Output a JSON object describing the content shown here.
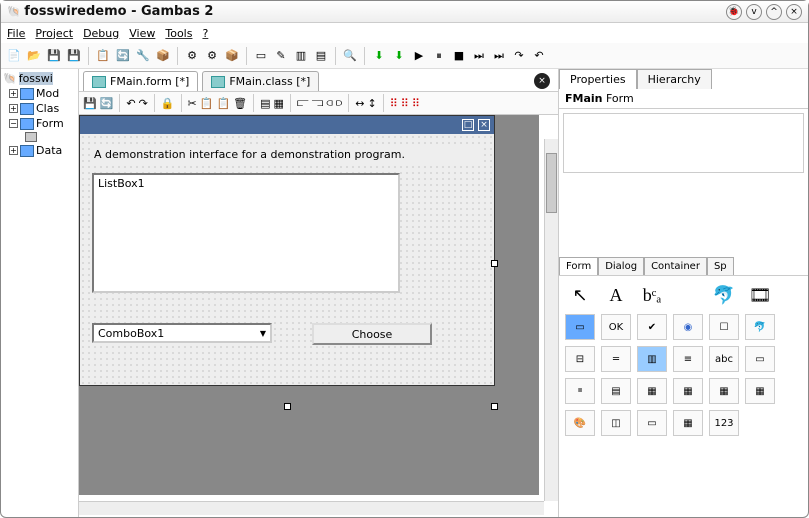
{
  "window": {
    "title": "fosswiredemo - Gambas 2"
  },
  "menubar": [
    "File",
    "Project",
    "Debug",
    "View",
    "Tools",
    "?"
  ],
  "sidebar": {
    "root": "fosswi",
    "items": [
      "Mod",
      "Clas",
      "Form",
      "Data"
    ]
  },
  "tabs": [
    {
      "label": "FMain.form [*]"
    },
    {
      "label": "FMain.class [*]"
    }
  ],
  "form": {
    "demo_label": "A demonstration interface for a demonstration program.",
    "listbox": "ListBox1",
    "combo": "ComboBox1",
    "choose": "Choose"
  },
  "properties": {
    "tabs": [
      "Properties",
      "Hierarchy"
    ],
    "header_name": "FMain",
    "header_type": "Form"
  },
  "toolbox": {
    "tabs": [
      "Form",
      "Dialog",
      "Container",
      "Sp"
    ],
    "items_row1": [
      "↖",
      "A",
      "bᶜₐ",
      "",
      "🐬",
      "🎞"
    ],
    "items_row2": [
      "▭",
      "OK",
      "✔",
      "◉",
      "☐",
      "🐬"
    ],
    "items_row3": [
      "⊟",
      "═",
      "▥",
      "≡",
      "abc",
      "▭"
    ],
    "items_row4": [
      "≣",
      "▤",
      "▦",
      "▦",
      "▦",
      "▦"
    ],
    "items_row5": [
      "🎨",
      "◫",
      "▭",
      "▦",
      "123",
      ""
    ]
  }
}
